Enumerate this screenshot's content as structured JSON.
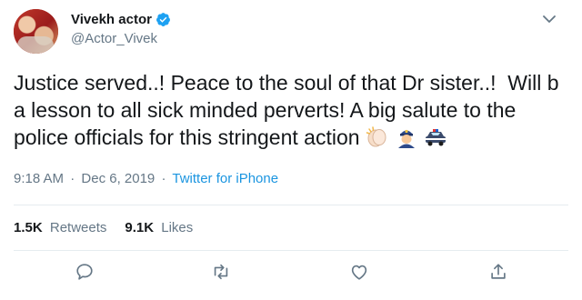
{
  "author": {
    "display_name": "Vivekh actor",
    "handle": "@Actor_Vivek",
    "verified": true
  },
  "tweet": {
    "text": "Justice served..! Peace to the soul of that Dr sister..!  Will b a lesson to all sick minded perverts! A big salute to the police officials for this stringent action",
    "emojis": [
      "clapping-hands-emoji",
      "police-officer-emoji",
      "police-car-emoji"
    ]
  },
  "meta": {
    "time": "9:18 AM",
    "separator": "·",
    "date": "Dec 6, 2019",
    "separator2": "·",
    "source": "Twitter for iPhone"
  },
  "stats": {
    "retweets_count": "1.5K",
    "retweets_label": "Retweets",
    "likes_count": "9.1K",
    "likes_label": "Likes"
  },
  "actions": [
    "reply-icon",
    "retweet-icon",
    "like-icon",
    "share-icon"
  ],
  "colors": {
    "text": "#14171a",
    "secondary": "#657786",
    "link": "#1b95e0",
    "divider": "#e6ecf0",
    "verified": "#1da1f2"
  }
}
